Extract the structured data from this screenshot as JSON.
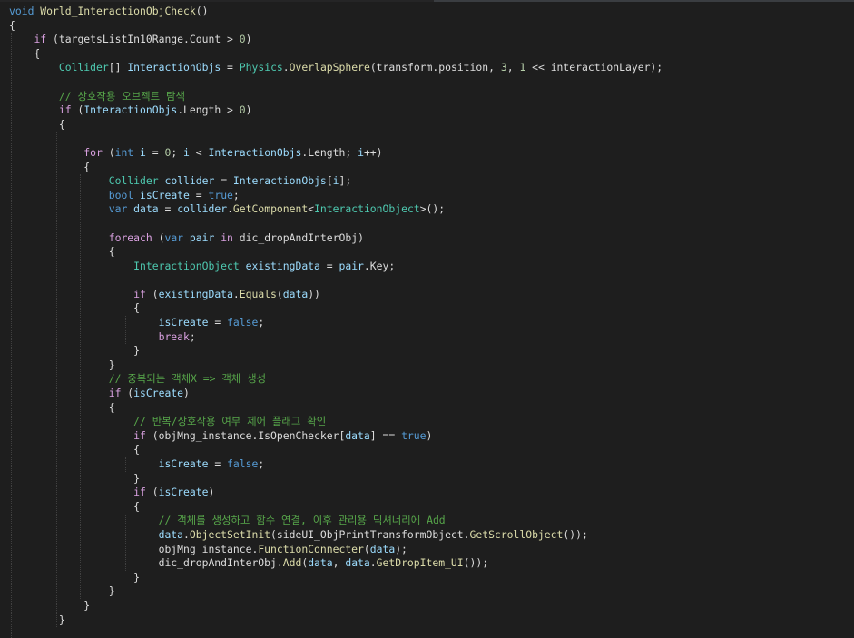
{
  "editor": {
    "colors": {
      "background": "#1e1e1e",
      "keyword": "#569cd6",
      "control": "#d8a0df",
      "type": "#4ec9b0",
      "method": "#dcdcaa",
      "variable": "#9cdcfe",
      "number": "#b5cea8",
      "comment": "#57a64a",
      "plain": "#dcdcdc"
    },
    "lines": [
      [
        [
          "keyword",
          "void"
        ],
        [
          "plain",
          " "
        ],
        [
          "method",
          "World_InteractionObjCheck"
        ],
        [
          "plain",
          "()"
        ]
      ],
      [
        [
          "plain",
          "{"
        ]
      ],
      [
        [
          "plain",
          "    "
        ],
        [
          "control",
          "if"
        ],
        [
          "plain",
          " (targetsListIn10Range.Count > "
        ],
        [
          "number",
          "0"
        ],
        [
          "plain",
          ")"
        ]
      ],
      [
        [
          "plain",
          "    {"
        ]
      ],
      [
        [
          "plain",
          "        "
        ],
        [
          "type",
          "Collider"
        ],
        [
          "plain",
          "[] "
        ],
        [
          "variable",
          "InteractionObjs"
        ],
        [
          "plain",
          " = "
        ],
        [
          "type",
          "Physics"
        ],
        [
          "plain",
          "."
        ],
        [
          "method",
          "OverlapSphere"
        ],
        [
          "plain",
          "(transform.position, "
        ],
        [
          "number",
          "3"
        ],
        [
          "plain",
          ", "
        ],
        [
          "number",
          "1"
        ],
        [
          "plain",
          " << interactionLayer);"
        ]
      ],
      [
        [
          "plain",
          ""
        ]
      ],
      [
        [
          "plain",
          "        "
        ],
        [
          "comment",
          "// 상호작용 오브젝트 탐색"
        ]
      ],
      [
        [
          "plain",
          "        "
        ],
        [
          "control",
          "if"
        ],
        [
          "plain",
          " ("
        ],
        [
          "variable",
          "InteractionObjs"
        ],
        [
          "plain",
          ".Length > "
        ],
        [
          "number",
          "0"
        ],
        [
          "plain",
          ")"
        ]
      ],
      [
        [
          "plain",
          "        {"
        ]
      ],
      [
        [
          "plain",
          ""
        ]
      ],
      [
        [
          "plain",
          "            "
        ],
        [
          "control",
          "for"
        ],
        [
          "plain",
          " ("
        ],
        [
          "keyword",
          "int"
        ],
        [
          "plain",
          " "
        ],
        [
          "variable",
          "i"
        ],
        [
          "plain",
          " = "
        ],
        [
          "number",
          "0"
        ],
        [
          "plain",
          "; "
        ],
        [
          "variable",
          "i"
        ],
        [
          "plain",
          " < "
        ],
        [
          "variable",
          "InteractionObjs"
        ],
        [
          "plain",
          ".Length; "
        ],
        [
          "variable",
          "i"
        ],
        [
          "plain",
          "++)"
        ]
      ],
      [
        [
          "plain",
          "            {"
        ]
      ],
      [
        [
          "plain",
          "                "
        ],
        [
          "type",
          "Collider"
        ],
        [
          "plain",
          " "
        ],
        [
          "variable",
          "collider"
        ],
        [
          "plain",
          " = "
        ],
        [
          "variable",
          "InteractionObjs"
        ],
        [
          "plain",
          "["
        ],
        [
          "variable",
          "i"
        ],
        [
          "plain",
          "];"
        ]
      ],
      [
        [
          "plain",
          "                "
        ],
        [
          "keyword",
          "bool"
        ],
        [
          "plain",
          " "
        ],
        [
          "variable",
          "isCreate"
        ],
        [
          "plain",
          " = "
        ],
        [
          "keyword",
          "true"
        ],
        [
          "plain",
          ";"
        ]
      ],
      [
        [
          "plain",
          "                "
        ],
        [
          "keyword",
          "var"
        ],
        [
          "plain",
          " "
        ],
        [
          "variable",
          "data"
        ],
        [
          "plain",
          " = "
        ],
        [
          "variable",
          "collider"
        ],
        [
          "plain",
          "."
        ],
        [
          "method",
          "GetComponent"
        ],
        [
          "plain",
          "<"
        ],
        [
          "type",
          "InteractionObject"
        ],
        [
          "plain",
          ">();"
        ]
      ],
      [
        [
          "plain",
          ""
        ]
      ],
      [
        [
          "plain",
          "                "
        ],
        [
          "control",
          "foreach"
        ],
        [
          "plain",
          " ("
        ],
        [
          "keyword",
          "var"
        ],
        [
          "plain",
          " "
        ],
        [
          "variable",
          "pair"
        ],
        [
          "plain",
          " "
        ],
        [
          "control",
          "in"
        ],
        [
          "plain",
          " dic_dropAndInterObj)"
        ]
      ],
      [
        [
          "plain",
          "                {"
        ]
      ],
      [
        [
          "plain",
          "                    "
        ],
        [
          "type",
          "InteractionObject"
        ],
        [
          "plain",
          " "
        ],
        [
          "variable",
          "existingData"
        ],
        [
          "plain",
          " = "
        ],
        [
          "variable",
          "pair"
        ],
        [
          "plain",
          ".Key;"
        ]
      ],
      [
        [
          "plain",
          ""
        ]
      ],
      [
        [
          "plain",
          "                    "
        ],
        [
          "control",
          "if"
        ],
        [
          "plain",
          " ("
        ],
        [
          "variable",
          "existingData"
        ],
        [
          "plain",
          "."
        ],
        [
          "method",
          "Equals"
        ],
        [
          "plain",
          "("
        ],
        [
          "variable",
          "data"
        ],
        [
          "plain",
          "))"
        ]
      ],
      [
        [
          "plain",
          "                    {"
        ]
      ],
      [
        [
          "plain",
          "                        "
        ],
        [
          "variable",
          "isCreate"
        ],
        [
          "plain",
          " = "
        ],
        [
          "keyword",
          "false"
        ],
        [
          "plain",
          ";"
        ]
      ],
      [
        [
          "plain",
          "                        "
        ],
        [
          "control",
          "break"
        ],
        [
          "plain",
          ";"
        ]
      ],
      [
        [
          "plain",
          "                    }"
        ]
      ],
      [
        [
          "plain",
          "                }"
        ]
      ],
      [
        [
          "plain",
          "                "
        ],
        [
          "comment",
          "// 중복되는 객체X => 객체 생성"
        ]
      ],
      [
        [
          "plain",
          "                "
        ],
        [
          "control",
          "if"
        ],
        [
          "plain",
          " ("
        ],
        [
          "variable",
          "isCreate"
        ],
        [
          "plain",
          ")"
        ]
      ],
      [
        [
          "plain",
          "                {"
        ]
      ],
      [
        [
          "plain",
          "                    "
        ],
        [
          "comment",
          "// 반복/상호작용 여부 제어 플래그 확인"
        ]
      ],
      [
        [
          "plain",
          "                    "
        ],
        [
          "control",
          "if"
        ],
        [
          "plain",
          " (objMng_instance.IsOpenChecker["
        ],
        [
          "variable",
          "data"
        ],
        [
          "plain",
          "] == "
        ],
        [
          "keyword",
          "true"
        ],
        [
          "plain",
          ")"
        ]
      ],
      [
        [
          "plain",
          "                    {"
        ]
      ],
      [
        [
          "plain",
          "                        "
        ],
        [
          "variable",
          "isCreate"
        ],
        [
          "plain",
          " = "
        ],
        [
          "keyword",
          "false"
        ],
        [
          "plain",
          ";"
        ]
      ],
      [
        [
          "plain",
          "                    }"
        ]
      ],
      [
        [
          "plain",
          "                    "
        ],
        [
          "control",
          "if"
        ],
        [
          "plain",
          " ("
        ],
        [
          "variable",
          "isCreate"
        ],
        [
          "plain",
          ")"
        ]
      ],
      [
        [
          "plain",
          "                    {"
        ]
      ],
      [
        [
          "plain",
          "                        "
        ],
        [
          "comment",
          "// 객체를 생성하고 함수 연결, 이후 관리용 딕셔너리에 Add"
        ]
      ],
      [
        [
          "plain",
          "                        "
        ],
        [
          "variable",
          "data"
        ],
        [
          "plain",
          "."
        ],
        [
          "method",
          "ObjectSetInit"
        ],
        [
          "plain",
          "(sideUI_ObjPrintTransformObject."
        ],
        [
          "method",
          "GetScrollObject"
        ],
        [
          "plain",
          "());"
        ]
      ],
      [
        [
          "plain",
          "                        objMng_instance."
        ],
        [
          "method",
          "FunctionConnecter"
        ],
        [
          "plain",
          "("
        ],
        [
          "variable",
          "data"
        ],
        [
          "plain",
          ");"
        ]
      ],
      [
        [
          "plain",
          "                        dic_dropAndInterObj."
        ],
        [
          "method",
          "Add"
        ],
        [
          "plain",
          "("
        ],
        [
          "variable",
          "data"
        ],
        [
          "plain",
          ", "
        ],
        [
          "variable",
          "data"
        ],
        [
          "plain",
          "."
        ],
        [
          "method",
          "GetDropItem_UI"
        ],
        [
          "plain",
          "());"
        ]
      ],
      [
        [
          "plain",
          "                    }"
        ]
      ],
      [
        [
          "plain",
          "                }"
        ]
      ],
      [
        [
          "plain",
          "            }"
        ]
      ],
      [
        [
          "plain",
          "        }"
        ]
      ],
      [
        [
          "plain",
          ""
        ]
      ]
    ]
  }
}
